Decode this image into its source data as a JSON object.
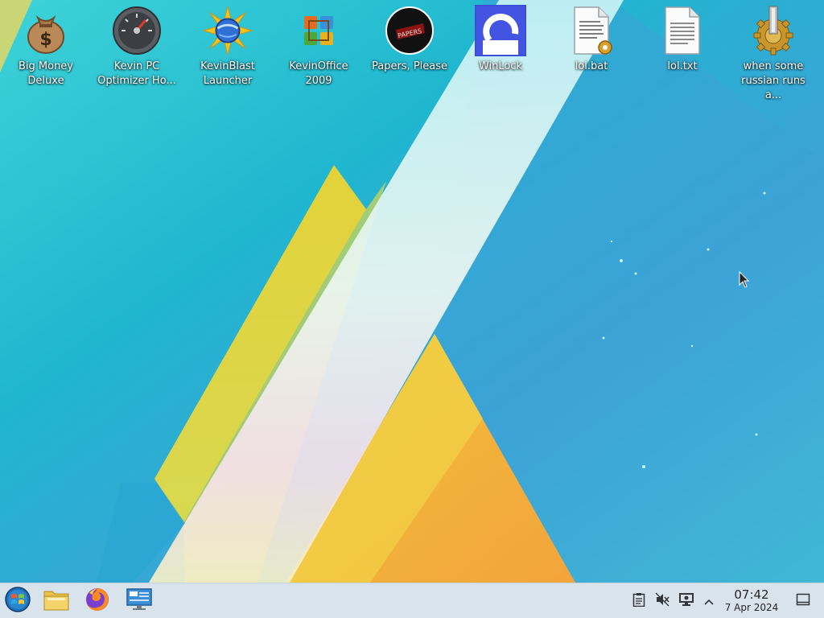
{
  "desktop": {
    "icons": [
      {
        "label": "Big Money Deluxe",
        "icon": "money-bag-icon"
      },
      {
        "label": "Kevin PC Optimizer Ho...",
        "icon": "speedometer-icon"
      },
      {
        "label": "KevinBlast Launcher",
        "icon": "globe-burst-icon"
      },
      {
        "label": "KevinOffice 2009",
        "icon": "office-logo-icon"
      },
      {
        "label": "Papers, Please",
        "icon": "papers-please-icon"
      },
      {
        "label": "WinLock",
        "icon": "winlock-icon"
      },
      {
        "label": "lol.bat",
        "icon": "batch-file-icon"
      },
      {
        "label": "lol.txt",
        "icon": "text-file-icon"
      },
      {
        "label": "when some russian runs a...",
        "icon": "gear-icon"
      }
    ]
  },
  "taskbar": {
    "start_icon": "start-orb-icon",
    "pinned": [
      {
        "name": "file-manager",
        "icon": "folder-icon"
      },
      {
        "name": "firefox",
        "icon": "firefox-icon"
      },
      {
        "name": "system-settings",
        "icon": "display-settings-icon"
      }
    ],
    "tray": [
      {
        "name": "clipboard",
        "icon": "clipboard-icon"
      },
      {
        "name": "volume-muted",
        "icon": "speaker-muted-icon"
      },
      {
        "name": "display",
        "icon": "monitor-icon"
      },
      {
        "name": "expand-tray",
        "icon": "chevron-up-icon"
      }
    ],
    "clock": {
      "time": "07:42",
      "date": "7 Apr 2024"
    },
    "show_desktop_icon": "show-desktop-icon"
  },
  "colors": {
    "wallpaper_base": "#2fc4d6",
    "wallpaper_yellow": "#e8d43a",
    "wallpaper_orange": "#f3b23c",
    "taskbar_bg": "#d9e3ec",
    "label_text": "#ffffff"
  }
}
